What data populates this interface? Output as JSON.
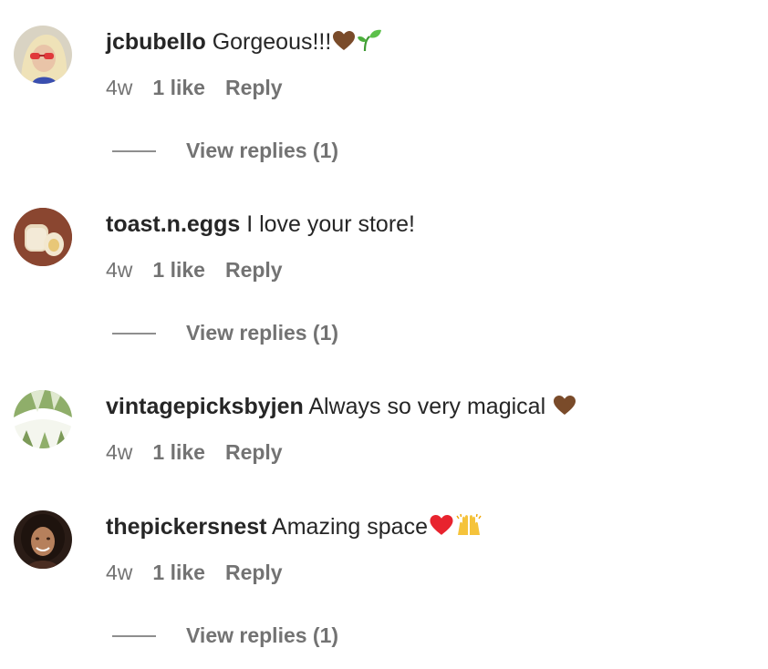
{
  "comments": [
    {
      "username": "jcbubello",
      "text": "Gorgeous!!!",
      "emojis": [
        "brown-heart",
        "seedling"
      ],
      "time": "4w",
      "likes": "1 like",
      "reply": "Reply",
      "view_replies": "View replies (1)"
    },
    {
      "username": "toast.n.eggs",
      "text": "I love your store!",
      "time": "4w",
      "likes": "1 like",
      "reply": "Reply",
      "view_replies": "View replies (1)"
    },
    {
      "username": "vintagepicksbyjen",
      "text": "Always so very magical",
      "emojis": [
        "brown-heart"
      ],
      "time": "4w",
      "likes": "1 like",
      "reply": "Reply"
    },
    {
      "username": "thepickersnest",
      "text": "Amazing space",
      "emojis": [
        "red-heart",
        "raising-hands"
      ],
      "time": "4w",
      "likes": "1 like",
      "reply": "Reply",
      "view_replies": "View replies (1)"
    }
  ],
  "colors": {
    "text": "#262626",
    "secondary": "#737373",
    "divider": "#8e8e8e",
    "brown_heart": "#7a4b2a",
    "red_heart": "#e8232e",
    "seedling": "#4caf3c",
    "raising_hands": "#f5c33b"
  }
}
